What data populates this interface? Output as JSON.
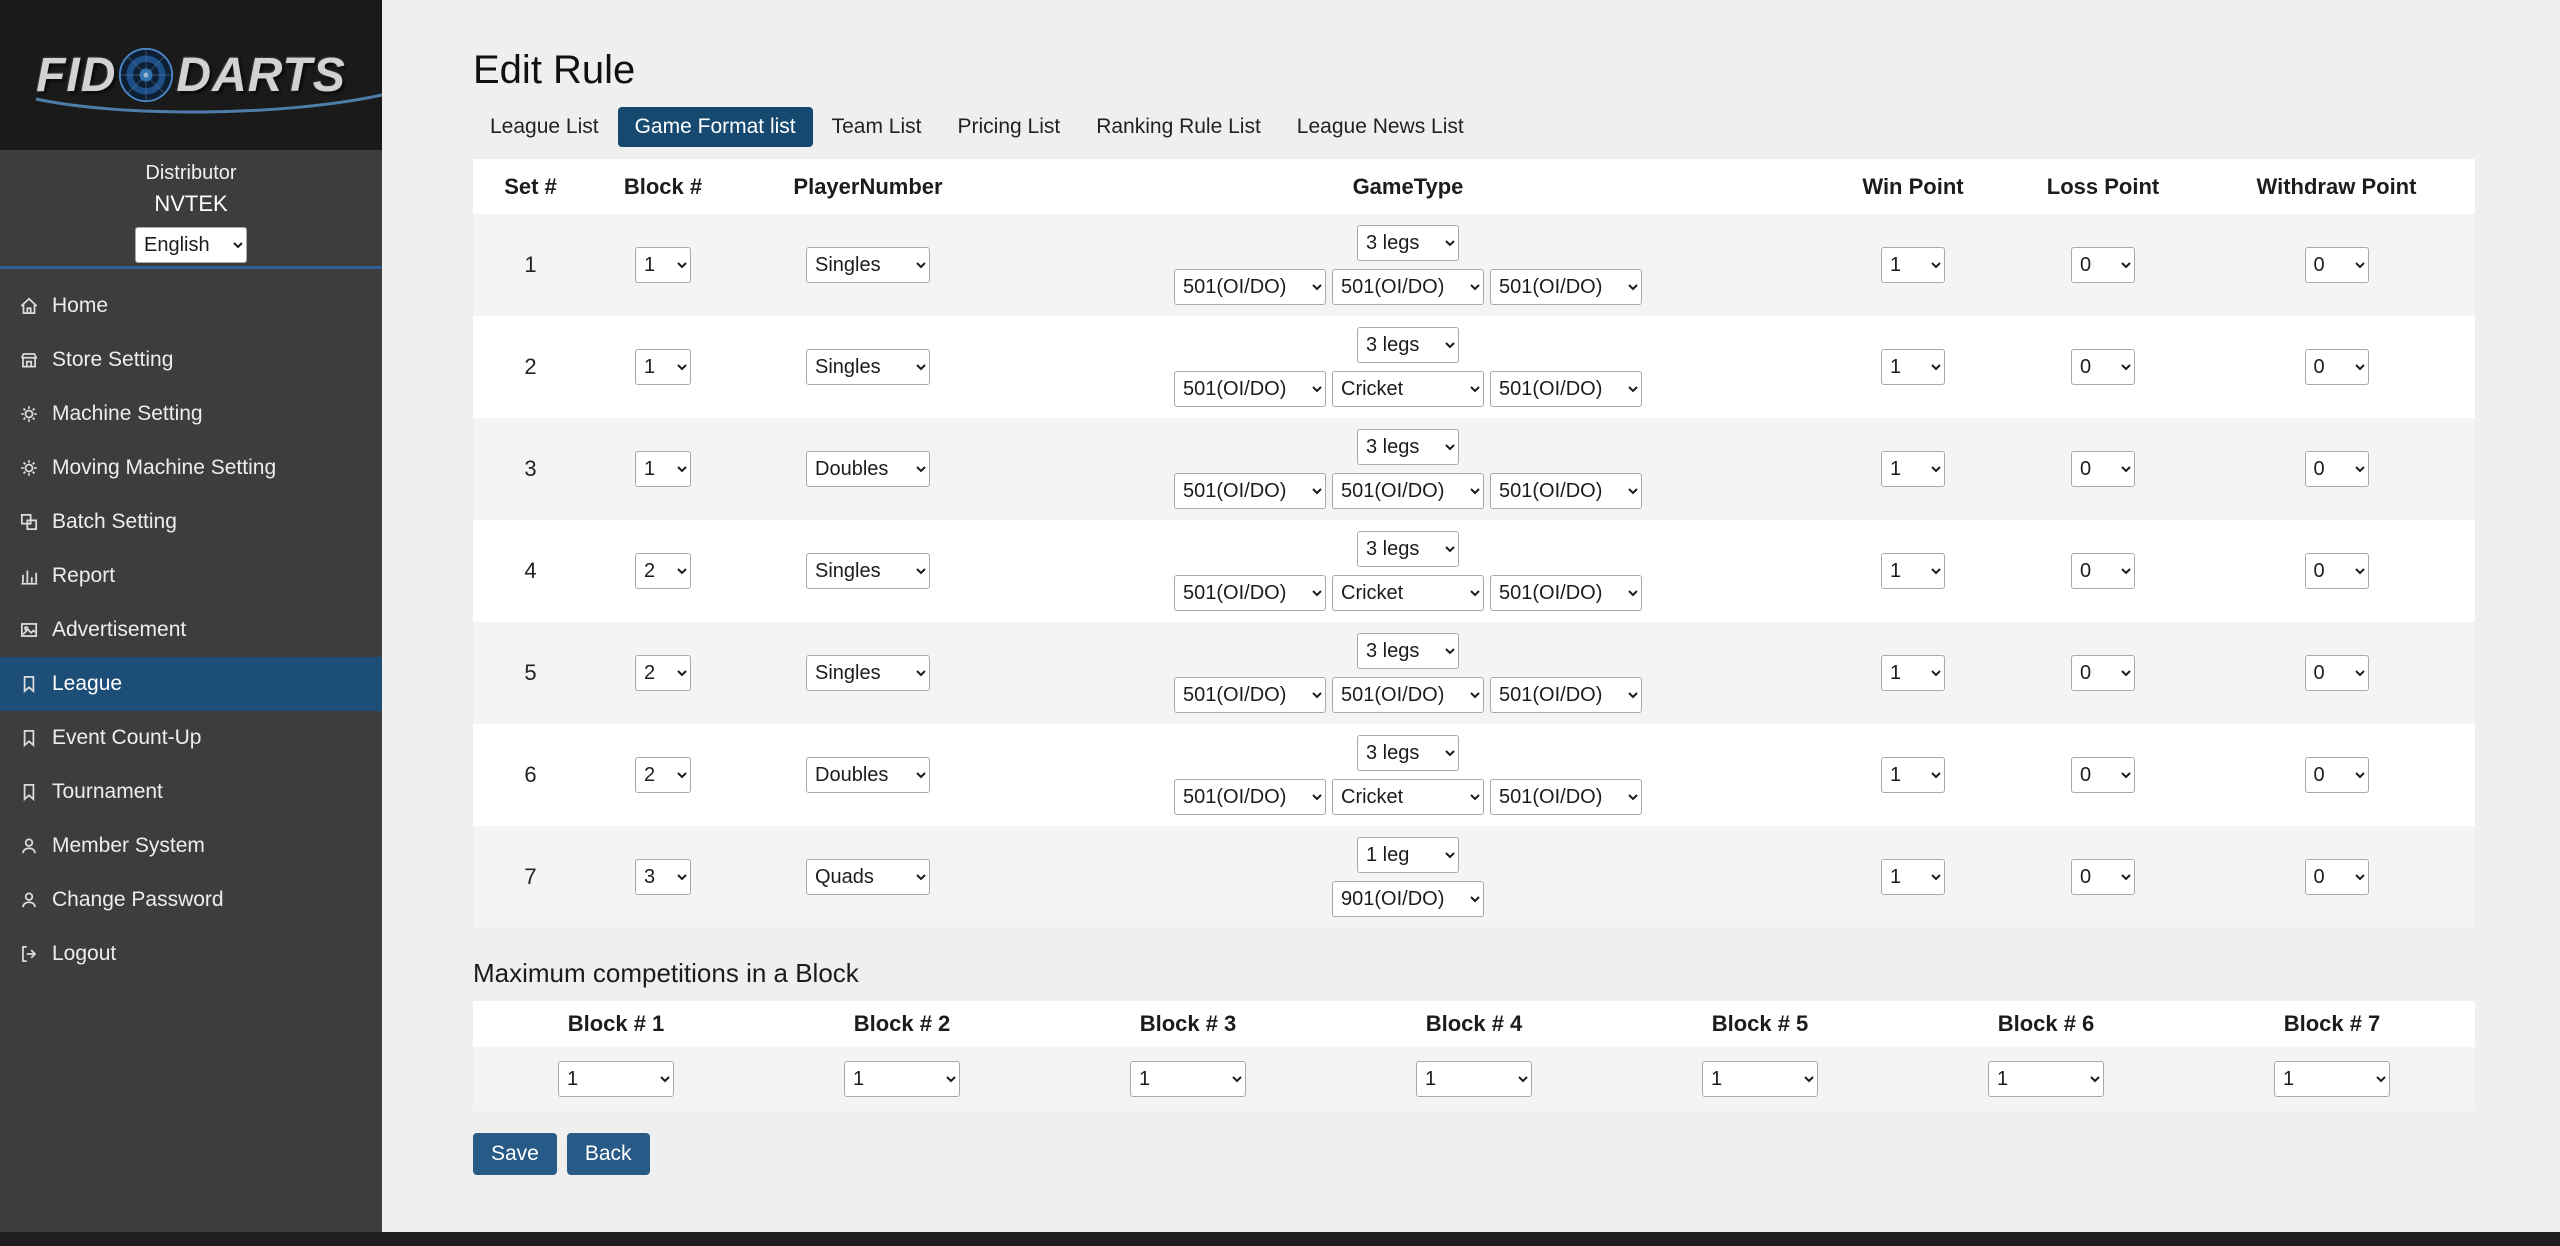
{
  "sidebar": {
    "logo": {
      "part1": "FID",
      "part2": "DARTS"
    },
    "role": "Distributor",
    "org": "NVTEK",
    "language": "English",
    "items": [
      {
        "label": "Home",
        "icon": "home"
      },
      {
        "label": "Store Setting",
        "icon": "store"
      },
      {
        "label": "Machine Setting",
        "icon": "gear"
      },
      {
        "label": "Moving Machine Setting",
        "icon": "gear"
      },
      {
        "label": "Batch Setting",
        "icon": "batch"
      },
      {
        "label": "Report",
        "icon": "bar-chart"
      },
      {
        "label": "Advertisement",
        "icon": "image"
      },
      {
        "label": "League",
        "icon": "bookmark",
        "active": true
      },
      {
        "label": "Event Count-Up",
        "icon": "bookmark"
      },
      {
        "label": "Tournament",
        "icon": "bookmark"
      },
      {
        "label": "Member System",
        "icon": "person"
      },
      {
        "label": "Change Password",
        "icon": "person"
      },
      {
        "label": "Logout",
        "icon": "logout"
      }
    ]
  },
  "page": {
    "title": "Edit Rule"
  },
  "tabs": [
    {
      "label": "League List",
      "active": false
    },
    {
      "label": "Game Format list",
      "active": true
    },
    {
      "label": "Team List",
      "active": false
    },
    {
      "label": "Pricing List",
      "active": false
    },
    {
      "label": "Ranking Rule List",
      "active": false
    },
    {
      "label": "League News List",
      "active": false
    }
  ],
  "format_table": {
    "headers": {
      "set": "Set #",
      "block": "Block #",
      "player": "PlayerNumber",
      "gametype": "GameType",
      "win": "Win Point",
      "loss": "Loss Point",
      "withdraw": "Withdraw Point"
    },
    "rows": [
      {
        "set": "1",
        "block": "1",
        "player": "Singles",
        "legs": "3 legs",
        "games": [
          "501(OI/DO)",
          "501(OI/DO)",
          "501(OI/DO)"
        ],
        "win": "1",
        "loss": "0",
        "withdraw": "0"
      },
      {
        "set": "2",
        "block": "1",
        "player": "Singles",
        "legs": "3 legs",
        "games": [
          "501(OI/DO)",
          "Cricket",
          "501(OI/DO)"
        ],
        "win": "1",
        "loss": "0",
        "withdraw": "0"
      },
      {
        "set": "3",
        "block": "1",
        "player": "Doubles",
        "legs": "3 legs",
        "games": [
          "501(OI/DO)",
          "501(OI/DO)",
          "501(OI/DO)"
        ],
        "win": "1",
        "loss": "0",
        "withdraw": "0"
      },
      {
        "set": "4",
        "block": "2",
        "player": "Singles",
        "legs": "3 legs",
        "games": [
          "501(OI/DO)",
          "Cricket",
          "501(OI/DO)"
        ],
        "win": "1",
        "loss": "0",
        "withdraw": "0"
      },
      {
        "set": "5",
        "block": "2",
        "player": "Singles",
        "legs": "3 legs",
        "games": [
          "501(OI/DO)",
          "501(OI/DO)",
          "501(OI/DO)"
        ],
        "win": "1",
        "loss": "0",
        "withdraw": "0"
      },
      {
        "set": "6",
        "block": "2",
        "player": "Doubles",
        "legs": "3 legs",
        "games": [
          "501(OI/DO)",
          "Cricket",
          "501(OI/DO)"
        ],
        "win": "1",
        "loss": "0",
        "withdraw": "0"
      },
      {
        "set": "7",
        "block": "3",
        "player": "Quads",
        "legs": "1 leg",
        "games": [
          null,
          "901(OI/DO)",
          null
        ],
        "win": "1",
        "loss": "0",
        "withdraw": "0"
      }
    ]
  },
  "max_section": {
    "title": "Maximum competitions in a Block",
    "headers": [
      "Block # 1",
      "Block # 2",
      "Block # 3",
      "Block # 4",
      "Block # 5",
      "Block # 6",
      "Block # 7"
    ],
    "values": [
      "1",
      "1",
      "1",
      "1",
      "1",
      "1",
      "1"
    ]
  },
  "actions": {
    "save": "Save",
    "back": "Back"
  },
  "colors": {
    "page_bg": "#efefef",
    "sidebar_bg": "#3d3d3d",
    "sidebar_top": "#1a1a1a",
    "sidebar_active": "#1d4e77",
    "divider": "#2d5f9a",
    "tab_active": "#15496f",
    "accent": "#275a86",
    "row_alt": "#f4f4f4",
    "footer": "#1f1f1f"
  }
}
